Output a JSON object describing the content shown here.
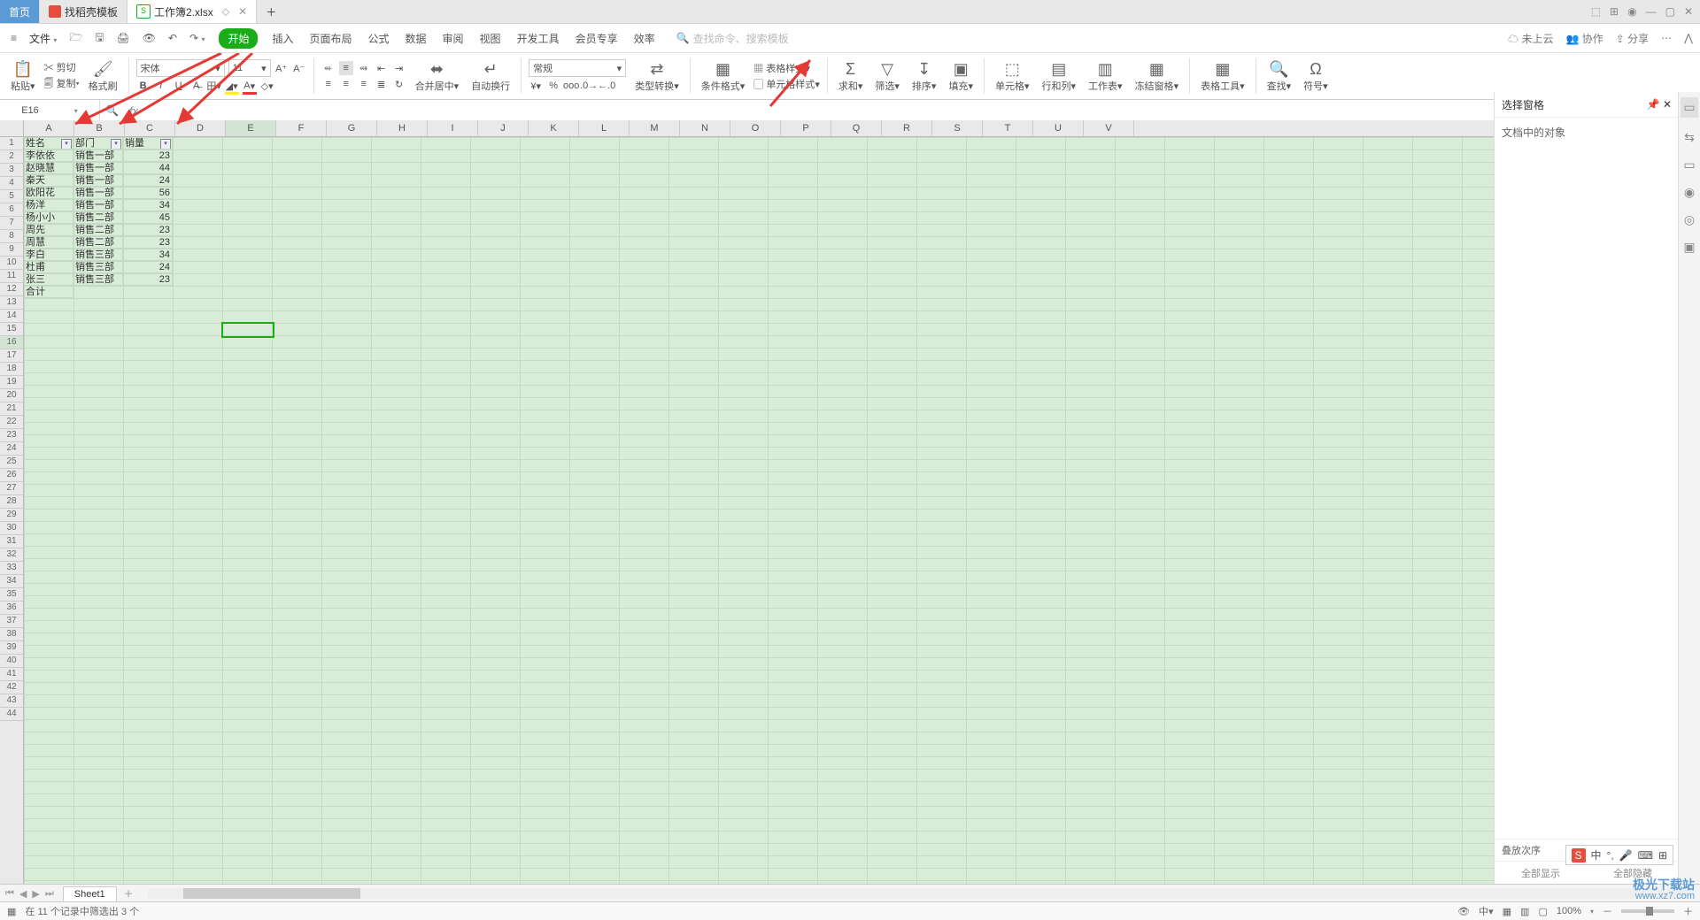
{
  "tabs": {
    "home": "首页",
    "doc1": "找稻壳模板",
    "doc2": "工作簿2.xlsx"
  },
  "menu": {
    "file": "文件"
  },
  "ribbon_tabs": [
    "开始",
    "插入",
    "页面布局",
    "公式",
    "数据",
    "审阅",
    "视图",
    "开发工具",
    "会员专享",
    "效率"
  ],
  "ribbon_active": 0,
  "search_placeholder": "查找命令、搜索模板",
  "cloud": {
    "sync": "未上云",
    "coop": "协作",
    "share": "分享"
  },
  "clip": {
    "paste": "粘贴",
    "cut": "剪切",
    "copy": "复制",
    "brush": "格式刷"
  },
  "font": {
    "name": "宋体",
    "size": "11"
  },
  "num": {
    "type": "常规"
  },
  "btns": {
    "merge": "合并居中",
    "wrap": "自动换行",
    "typeconv": "类型转换",
    "condfmt": "条件格式",
    "tblstyle": "表格样式",
    "cellstyle": "单元格样式",
    "sum": "求和",
    "filter": "筛选",
    "sort": "排序",
    "fill": "填充",
    "cell": "单元格",
    "rowcol": "行和列",
    "sheet": "工作表",
    "freeze": "冻结窗格",
    "tbltool": "表格工具",
    "find": "查找",
    "symbol": "符号"
  },
  "cellref": "E16",
  "cols": [
    "A",
    "B",
    "C",
    "D",
    "E",
    "F",
    "G",
    "H",
    "I",
    "J",
    "K",
    "L",
    "M",
    "N",
    "O",
    "P",
    "Q",
    "R",
    "S",
    "T",
    "U",
    "V"
  ],
  "headers": {
    "a": "姓名",
    "b": "部门",
    "c": "销量"
  },
  "rows": [
    {
      "a": "李依依",
      "b": "销售一部",
      "c": "23"
    },
    {
      "a": "赵晓慧",
      "b": "销售一部",
      "c": "44"
    },
    {
      "a": "秦天",
      "b": "销售一部",
      "c": "24"
    },
    {
      "a": "欧阳花",
      "b": "销售一部",
      "c": "56"
    },
    {
      "a": "杨洋",
      "b": "销售一部",
      "c": "34"
    },
    {
      "a": "杨小小",
      "b": "销售二部",
      "c": "45"
    },
    {
      "a": "周先",
      "b": "销售二部",
      "c": "23"
    },
    {
      "a": "周慧",
      "b": "销售二部",
      "c": "23"
    },
    {
      "a": "李白",
      "b": "销售三部",
      "c": "34"
    },
    {
      "a": "杜甫",
      "b": "销售三部",
      "c": "24"
    },
    {
      "a": "张三",
      "b": "销售三部",
      "c": "23"
    }
  ],
  "total_label": "合计",
  "rightpane": {
    "title": "选择窗格",
    "sub": "文档中的对象",
    "order": "叠放次序",
    "showall": "全部显示",
    "hideall": "全部隐藏"
  },
  "sheet": "Sheet1",
  "status": "在 11 个记录中筛选出 3 个",
  "zoom": "100%",
  "ime": {
    "lang": "中"
  },
  "watermark": {
    "a": "极光下载站",
    "b": "www.xz7.com"
  },
  "colw": {
    "A": 56,
    "B": 56,
    "C": 56,
    "D": 56,
    "E": 56,
    "other": 56
  }
}
